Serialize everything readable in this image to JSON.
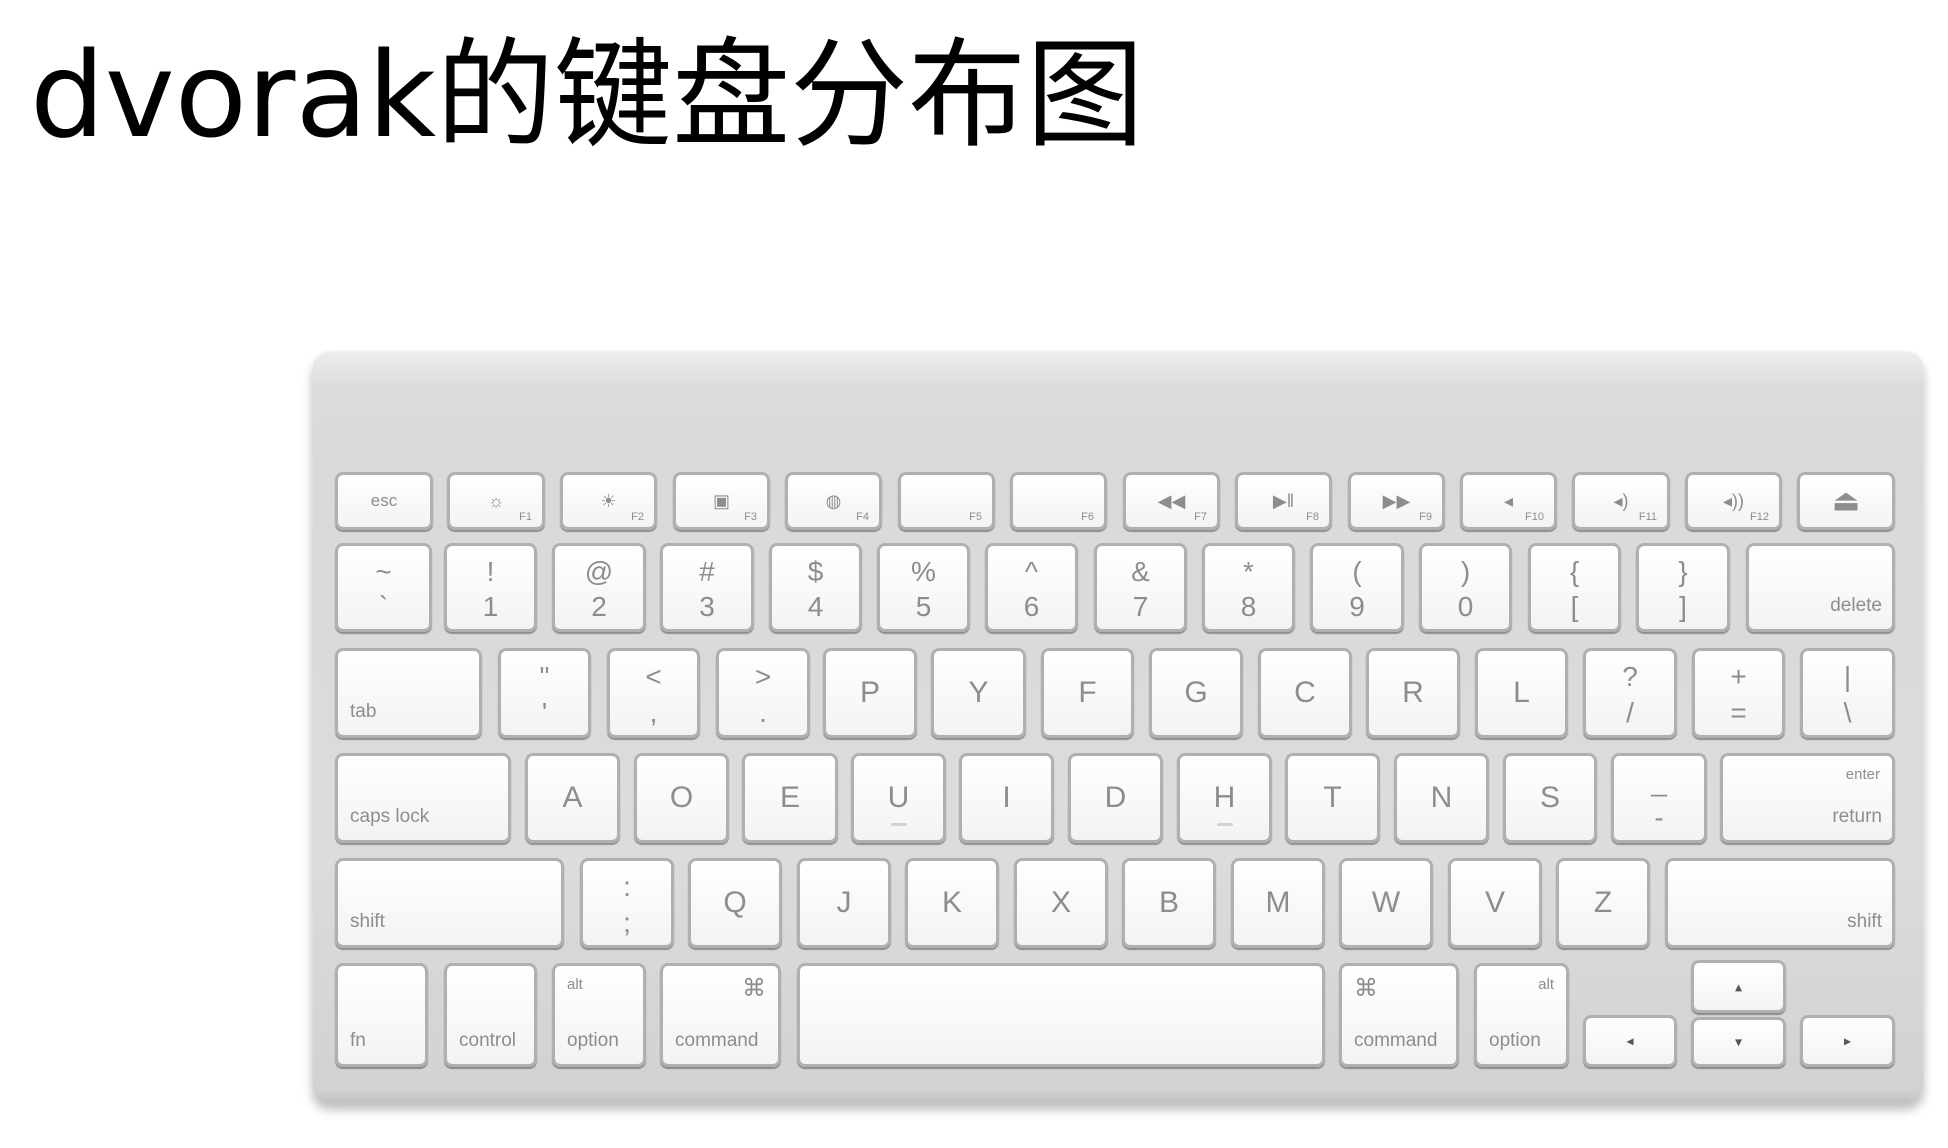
{
  "title": "dvorak的键盘分布图",
  "keyboard": {
    "rows": [
      [
        {
          "kind": "esc",
          "label": "esc"
        },
        {
          "kind": "fn",
          "icon": "☼",
          "num": "F1",
          "icon_name": "brightness-down-icon"
        },
        {
          "kind": "fn",
          "icon": "☀",
          "num": "F2",
          "icon_name": "brightness-up-icon"
        },
        {
          "kind": "fn",
          "icon": "▣",
          "num": "F3",
          "icon_name": "expose-icon"
        },
        {
          "kind": "fn",
          "icon": "◍",
          "num": "F4",
          "icon_name": "dashboard-icon"
        },
        {
          "kind": "fn",
          "icon": "",
          "num": "F5"
        },
        {
          "kind": "fn",
          "icon": "",
          "num": "F6"
        },
        {
          "kind": "fn",
          "icon": "◀◀",
          "num": "F7",
          "icon_name": "rewind-icon"
        },
        {
          "kind": "fn",
          "icon": "▶ǁ",
          "num": "F8",
          "icon_name": "play-pause-icon"
        },
        {
          "kind": "fn",
          "icon": "▶▶",
          "num": "F9",
          "icon_name": "fast-forward-icon"
        },
        {
          "kind": "fn",
          "icon": "◂",
          "num": "F10",
          "icon_name": "mute-icon"
        },
        {
          "kind": "fn",
          "icon": "◂)",
          "num": "F11",
          "icon_name": "volume-down-icon"
        },
        {
          "kind": "fn",
          "icon": "◂))",
          "num": "F12",
          "icon_name": "volume-up-icon"
        },
        {
          "kind": "eject",
          "icon": "⏏",
          "icon_name": "eject-icon"
        }
      ],
      [
        {
          "kind": "dual",
          "top": "~",
          "bot": "`"
        },
        {
          "kind": "dual",
          "top": "!",
          "bot": "1"
        },
        {
          "kind": "dual",
          "top": "@",
          "bot": "2"
        },
        {
          "kind": "dual",
          "top": "#",
          "bot": "3"
        },
        {
          "kind": "dual",
          "top": "$",
          "bot": "4"
        },
        {
          "kind": "dual",
          "top": "%",
          "bot": "5"
        },
        {
          "kind": "dual",
          "top": "^",
          "bot": "6"
        },
        {
          "kind": "dual",
          "top": "&",
          "bot": "7"
        },
        {
          "kind": "dual",
          "top": "*",
          "bot": "8"
        },
        {
          "kind": "dual",
          "top": "(",
          "bot": "9"
        },
        {
          "kind": "dual",
          "top": ")",
          "bot": "0"
        },
        {
          "kind": "dual",
          "top": "{",
          "bot": "["
        },
        {
          "kind": "dual",
          "top": "}",
          "bot": "]"
        },
        {
          "kind": "mod",
          "br": "delete"
        }
      ],
      [
        {
          "kind": "mod",
          "bl": "tab"
        },
        {
          "kind": "dual",
          "top": "\"",
          "bot": "'"
        },
        {
          "kind": "dual",
          "top": "<",
          "bot": ","
        },
        {
          "kind": "dual",
          "top": ">",
          "bot": "."
        },
        {
          "kind": "letter",
          "label": "P"
        },
        {
          "kind": "letter",
          "label": "Y"
        },
        {
          "kind": "letter",
          "label": "F"
        },
        {
          "kind": "letter",
          "label": "G"
        },
        {
          "kind": "letter",
          "label": "C"
        },
        {
          "kind": "letter",
          "label": "R"
        },
        {
          "kind": "letter",
          "label": "L"
        },
        {
          "kind": "dual",
          "top": "?",
          "bot": "/"
        },
        {
          "kind": "dual",
          "top": "+",
          "bot": "="
        },
        {
          "kind": "dual",
          "top": "|",
          "bot": "\\"
        }
      ],
      [
        {
          "kind": "mod",
          "bl": "caps lock"
        },
        {
          "kind": "letter",
          "label": "A"
        },
        {
          "kind": "letter",
          "label": "O"
        },
        {
          "kind": "letter",
          "label": "E"
        },
        {
          "kind": "letter",
          "label": "U",
          "bump": true
        },
        {
          "kind": "letter",
          "label": "I"
        },
        {
          "kind": "letter",
          "label": "D"
        },
        {
          "kind": "letter",
          "label": "H",
          "bump": true
        },
        {
          "kind": "letter",
          "label": "T"
        },
        {
          "kind": "letter",
          "label": "N"
        },
        {
          "kind": "letter",
          "label": "S"
        },
        {
          "kind": "dual",
          "top": "_",
          "bot": "-"
        },
        {
          "kind": "mod",
          "tr": "enter",
          "br": "return"
        }
      ],
      [
        {
          "kind": "mod",
          "bl": "shift"
        },
        {
          "kind": "dual",
          "top": ":",
          "bot": ";"
        },
        {
          "kind": "letter",
          "label": "Q"
        },
        {
          "kind": "letter",
          "label": "J"
        },
        {
          "kind": "letter",
          "label": "K"
        },
        {
          "kind": "letter",
          "label": "X"
        },
        {
          "kind": "letter",
          "label": "B"
        },
        {
          "kind": "letter",
          "label": "M"
        },
        {
          "kind": "letter",
          "label": "W"
        },
        {
          "kind": "letter",
          "label": "V"
        },
        {
          "kind": "letter",
          "label": "Z"
        },
        {
          "kind": "mod",
          "br": "shift"
        }
      ],
      [
        {
          "kind": "mod",
          "bl": "fn"
        },
        {
          "kind": "mod",
          "bl": "control"
        },
        {
          "kind": "mod",
          "tl": "alt",
          "bl": "option"
        },
        {
          "kind": "mod",
          "tr_sym": "⌘",
          "bl": "command"
        },
        {
          "kind": "space"
        },
        {
          "kind": "mod",
          "tl_sym": "⌘",
          "bl": "command"
        },
        {
          "kind": "mod",
          "tr": "alt",
          "bl": "option"
        },
        {
          "kind": "arrow",
          "icon": "◂",
          "icon_name": "arrow-left-icon"
        },
        {
          "kind": "arrow",
          "icon": "▴",
          "icon_name": "arrow-up-icon"
        },
        {
          "kind": "arrow",
          "icon": "▾",
          "icon_name": "arrow-down-icon"
        },
        {
          "kind": "arrow",
          "icon": "▸",
          "icon_name": "arrow-right-icon"
        }
      ]
    ]
  }
}
